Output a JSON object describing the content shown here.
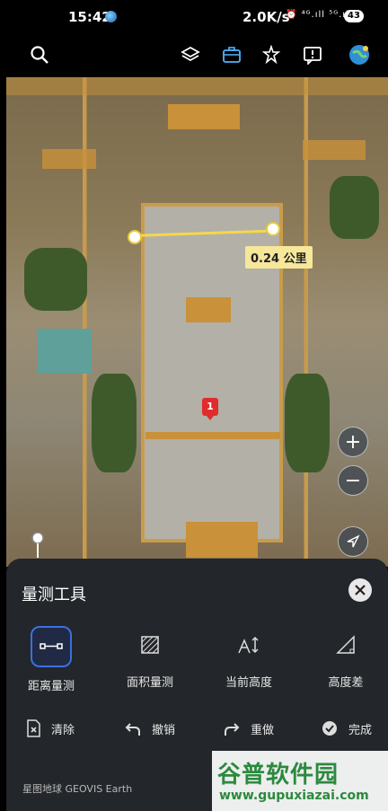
{
  "status_bar": {
    "time": "15:42",
    "net_speed": "2.0K/s",
    "signal": "⏰ ⁴ᴳ.ıll ⁵ᴳ.ıll",
    "battery": "43"
  },
  "toolbar": {
    "icons": [
      "search-icon",
      "layers-icon",
      "toolbox-icon",
      "pin-icon",
      "report-icon",
      "globe-avatar-icon"
    ]
  },
  "map": {
    "measure_label": "0.24 公里",
    "marker_label": "1"
  },
  "zoom": {
    "in": "+",
    "out": "−"
  },
  "panel": {
    "title": "量测工具",
    "tools": [
      {
        "label": "距离量测",
        "selected": true
      },
      {
        "label": "面积量测",
        "selected": false
      },
      {
        "label": "当前高度",
        "selected": false
      },
      {
        "label": "高度差",
        "selected": false
      }
    ],
    "actions": [
      {
        "label": "清除"
      },
      {
        "label": "撤销"
      },
      {
        "label": "重做"
      },
      {
        "label": "完成"
      }
    ],
    "footer": "星图地球 GEOVIS Earth"
  },
  "watermark": {
    "line1": "谷普软件园",
    "line2": "www.gupuxiazai.com"
  },
  "colors": {
    "accent": "#3d6fe0",
    "panel_bg": "#23262a",
    "measure_line": "#f5d84a",
    "marker": "#e02c2c"
  }
}
